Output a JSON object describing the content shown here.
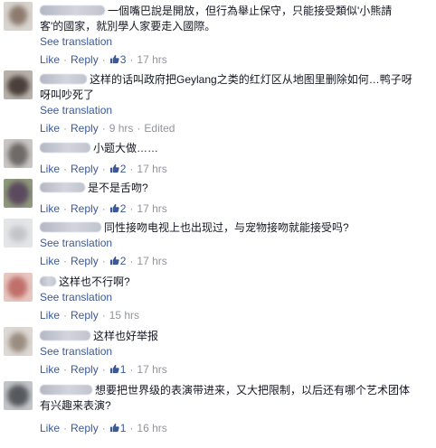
{
  "labels": {
    "see_translation": "See translation",
    "like": "Like",
    "reply": "Reply",
    "edited": "Edited"
  },
  "colors": {
    "link": "#3b5998",
    "meta": "#90949c",
    "text": "#141823"
  },
  "comments": [
    {
      "text_lines": [
        "一個嘴巴說是開放，但行為舉止保守，只能接受類似'小熊請",
        "客'的國家，就別學人家要走入國際。"
      ],
      "has_translation": true,
      "likes": "3",
      "time": "17 hrs",
      "edited": false
    },
    {
      "text_lines": [
        "这样的话叫政府把Geylang之类的红灯区从地图里删除如何…鸭子呀",
        "呀叫吵死了"
      ],
      "has_translation": true,
      "likes": "",
      "time": "9 hrs",
      "edited": true
    },
    {
      "text_lines": [
        "小题大做……"
      ],
      "has_translation": false,
      "likes": "2",
      "time": "17 hrs",
      "edited": false
    },
    {
      "text_lines": [
        "是不是舌吻?"
      ],
      "has_translation": false,
      "likes": "2",
      "time": "17 hrs",
      "edited": false
    },
    {
      "text_lines": [
        "同性接吻电视上也出现过，与宠物接吻就能接受吗?"
      ],
      "has_translation": true,
      "likes": "2",
      "time": "17 hrs",
      "edited": false
    },
    {
      "text_lines": [
        "这样也不行啊?"
      ],
      "has_translation": true,
      "likes": "",
      "time": "15 hrs",
      "edited": false
    },
    {
      "text_lines": [
        "这样也好举报"
      ],
      "has_translation": true,
      "likes": "1",
      "time": "17 hrs",
      "edited": false
    },
    {
      "text_lines": [
        "想要把世界级的表演带进来，又大把限制，以后还有哪个艺术团体",
        "有兴趣来表演?"
      ],
      "has_translation": false,
      "likes": "1",
      "time": "16 hrs",
      "edited": false
    }
  ]
}
